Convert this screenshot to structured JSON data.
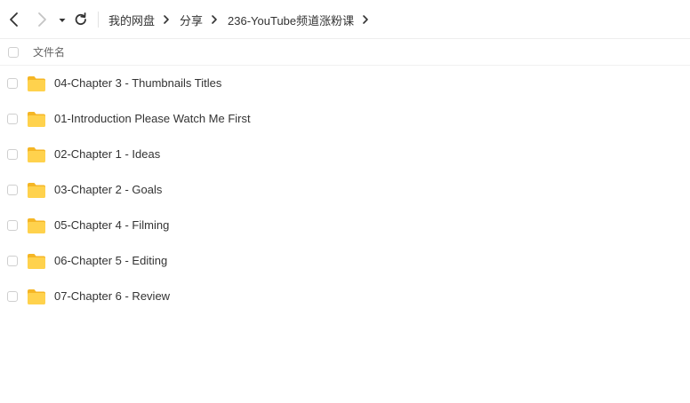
{
  "toolbar": {
    "back_icon": "chevron-left-icon",
    "forward_icon": "chevron-right-icon",
    "dropdown_icon": "caret-down-icon",
    "refresh_icon": "refresh-icon",
    "breadcrumb": [
      "我的网盘",
      "分享",
      "236-YouTube频道涨粉课"
    ]
  },
  "list_header": {
    "name_column": "文件名"
  },
  "files": [
    {
      "name": "04-Chapter 3 - Thumbnails  Titles",
      "type": "folder"
    },
    {
      "name": "01-Introduction Please Watch Me First",
      "type": "folder"
    },
    {
      "name": "02-Chapter 1 - Ideas",
      "type": "folder"
    },
    {
      "name": "03-Chapter 2 - Goals",
      "type": "folder"
    },
    {
      "name": "05-Chapter 4 - Filming",
      "type": "folder"
    },
    {
      "name": "06-Chapter 5 - Editing",
      "type": "folder"
    },
    {
      "name": "07-Chapter 6 - Review",
      "type": "folder"
    }
  ],
  "colors": {
    "folder_body": "#FFD24D",
    "folder_tab": "#F5B625",
    "text": "#333333",
    "nav_disabled": "#c4c4c4"
  }
}
